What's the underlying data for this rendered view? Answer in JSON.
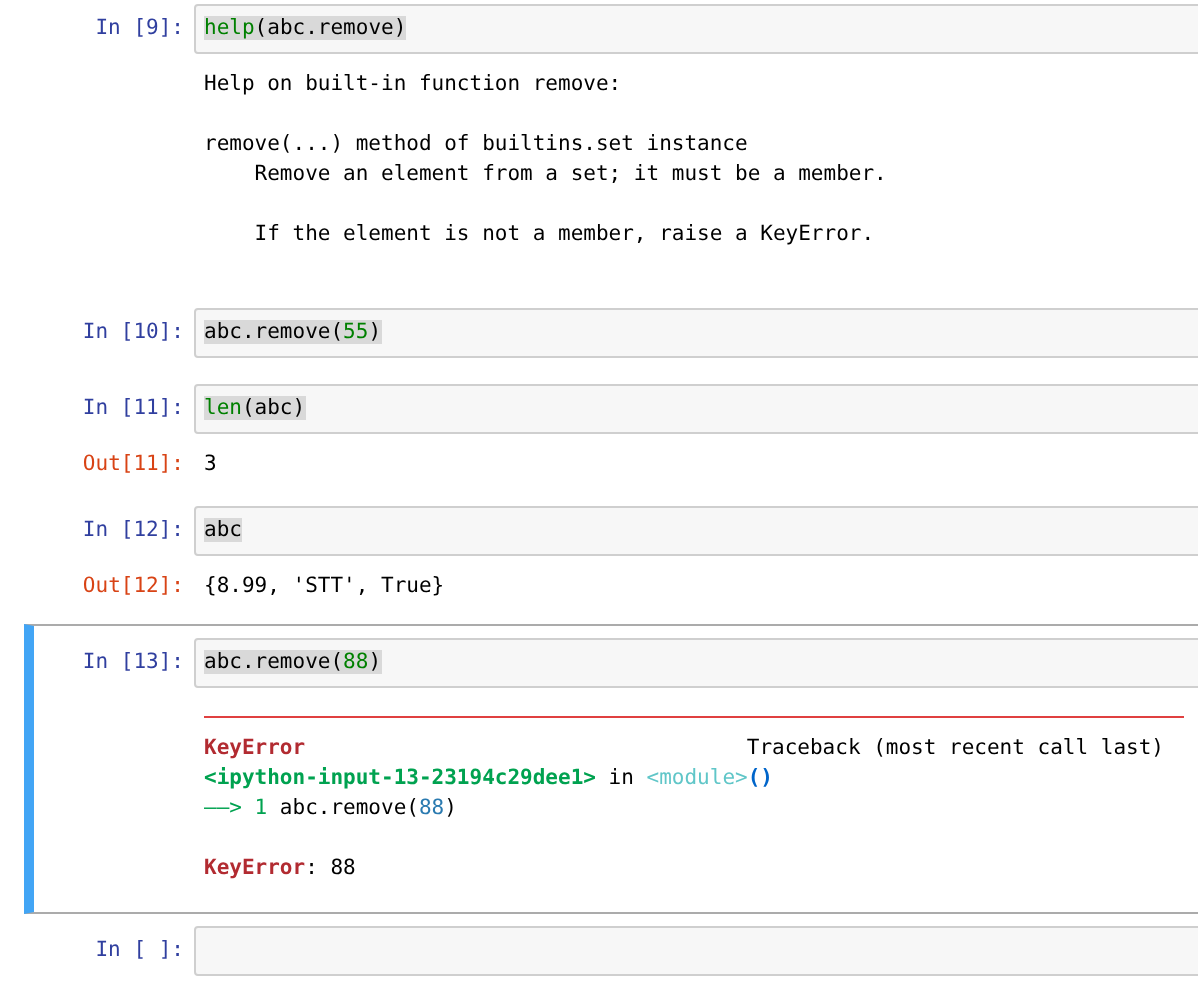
{
  "cells": [
    {
      "prompt": "In [9]:",
      "selected": false,
      "code": [
        {
          "kind": "builtin",
          "text": "help"
        },
        {
          "kind": "plain",
          "text": "(abc.remove)"
        }
      ],
      "output": {
        "kind": "text",
        "paragraphs": [
          [
            "Help on built-in function remove:"
          ],
          [
            "remove(...) method of builtins.set instance",
            "    Remove an element from a set; it must be a member."
          ],
          [
            "    If the element is not a member, raise a KeyError."
          ]
        ]
      }
    },
    {
      "prompt": "In [10]:",
      "selected": false,
      "code": [
        {
          "kind": "plain",
          "text": "abc.remove("
        },
        {
          "kind": "number",
          "text": "55"
        },
        {
          "kind": "plain",
          "text": ")"
        }
      ]
    },
    {
      "prompt": "In [11]:",
      "selected": false,
      "code": [
        {
          "kind": "builtin",
          "text": "len"
        },
        {
          "kind": "plain",
          "text": "(abc)"
        }
      ],
      "output": {
        "kind": "result",
        "prompt": "Out[11]:",
        "lines": [
          "3"
        ]
      }
    },
    {
      "prompt": "In [12]:",
      "selected": false,
      "code": [
        {
          "kind": "plain",
          "text": "abc"
        }
      ],
      "output": {
        "kind": "result",
        "prompt": "Out[12]:",
        "lines": [
          "{8.99, 'STT', True}"
        ]
      }
    },
    {
      "prompt": "In [13]:",
      "selected": true,
      "code": [
        {
          "kind": "plain",
          "text": "abc.remove("
        },
        {
          "kind": "number",
          "text": "88"
        },
        {
          "kind": "plain",
          "text": ")"
        }
      ],
      "output": {
        "kind": "error",
        "ename": "KeyError",
        "traceback_header": "Traceback (most recent call last)",
        "paragraphs": [
          [
            [
              {
                "kind": "file",
                "text": "<ipython-input-13-23194c29dee1>"
              },
              {
                "kind": "plain",
                "text": " in "
              },
              {
                "kind": "module",
                "text": "<module>"
              },
              {
                "kind": "paren",
                "text": "()"
              }
            ],
            [
              {
                "kind": "arrow",
                "text": "——> 1"
              },
              {
                "kind": "plain",
                "text": " abc.remove("
              },
              {
                "kind": "tbnum",
                "text": "88"
              },
              {
                "kind": "plain",
                "text": ")"
              }
            ]
          ],
          [
            [
              {
                "kind": "ename",
                "text": "KeyError"
              },
              {
                "kind": "plain",
                "text": ": 88"
              }
            ]
          ]
        ]
      }
    },
    {
      "prompt": "In [ ]:",
      "selected": false
    }
  ]
}
